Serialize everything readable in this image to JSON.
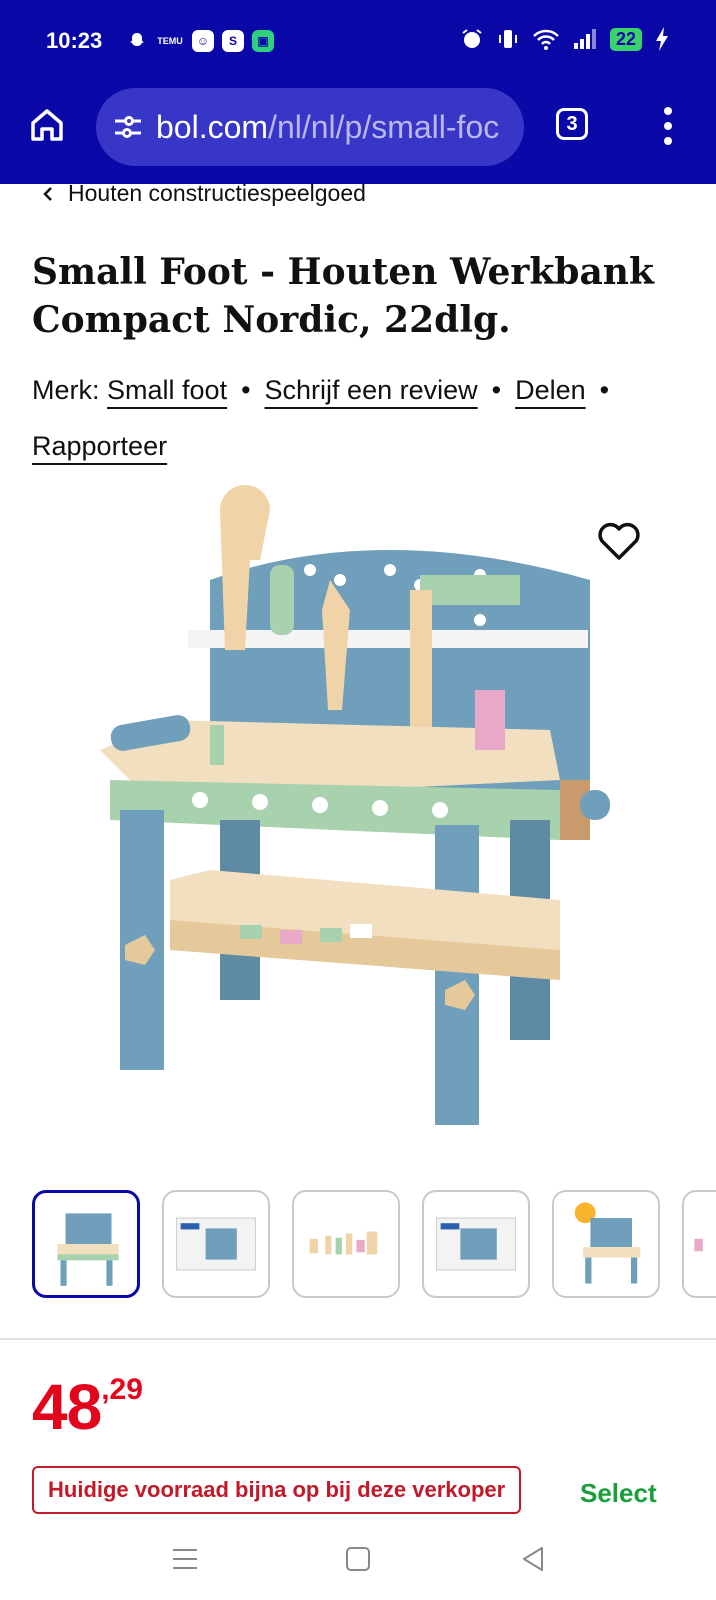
{
  "status_bar": {
    "time": "10:23",
    "battery": "22",
    "left_icons": [
      "snapchat-icon",
      "temu-icon",
      "chat-icon",
      "shazam-icon",
      "app-icon"
    ],
    "temu_label": "TEMU",
    "right_icons": [
      "alarm-icon",
      "vibrate-icon",
      "wifi-icon",
      "signal-icon",
      "battery-icon",
      "charging-icon"
    ]
  },
  "browser": {
    "url_host": "bol.com",
    "url_path": "/nl/nl/p/small-foc",
    "tab_count": "3"
  },
  "product": {
    "breadcrumb": "Houten constructiespeelgoed",
    "title": "Small Foot - Houten Werkbank Compact Nordic, 22dlg.",
    "brand_prefix": "Merk:",
    "brand": "Small foot",
    "write_review": "Schrijf een review",
    "share": "Delen",
    "report": "Rapporteer",
    "dot": "•",
    "price_euros": "48",
    "price_cents": ",29",
    "stock_notice": "Huidige voorraad bijna op bij deze verkoper",
    "select_label": "Select"
  },
  "colors": {
    "chrome": "#0a08a6",
    "price": "#e3051c",
    "select": "#1a9e3c",
    "bench_blue": "#6f9fbb",
    "bench_green": "#a8d1ad"
  }
}
